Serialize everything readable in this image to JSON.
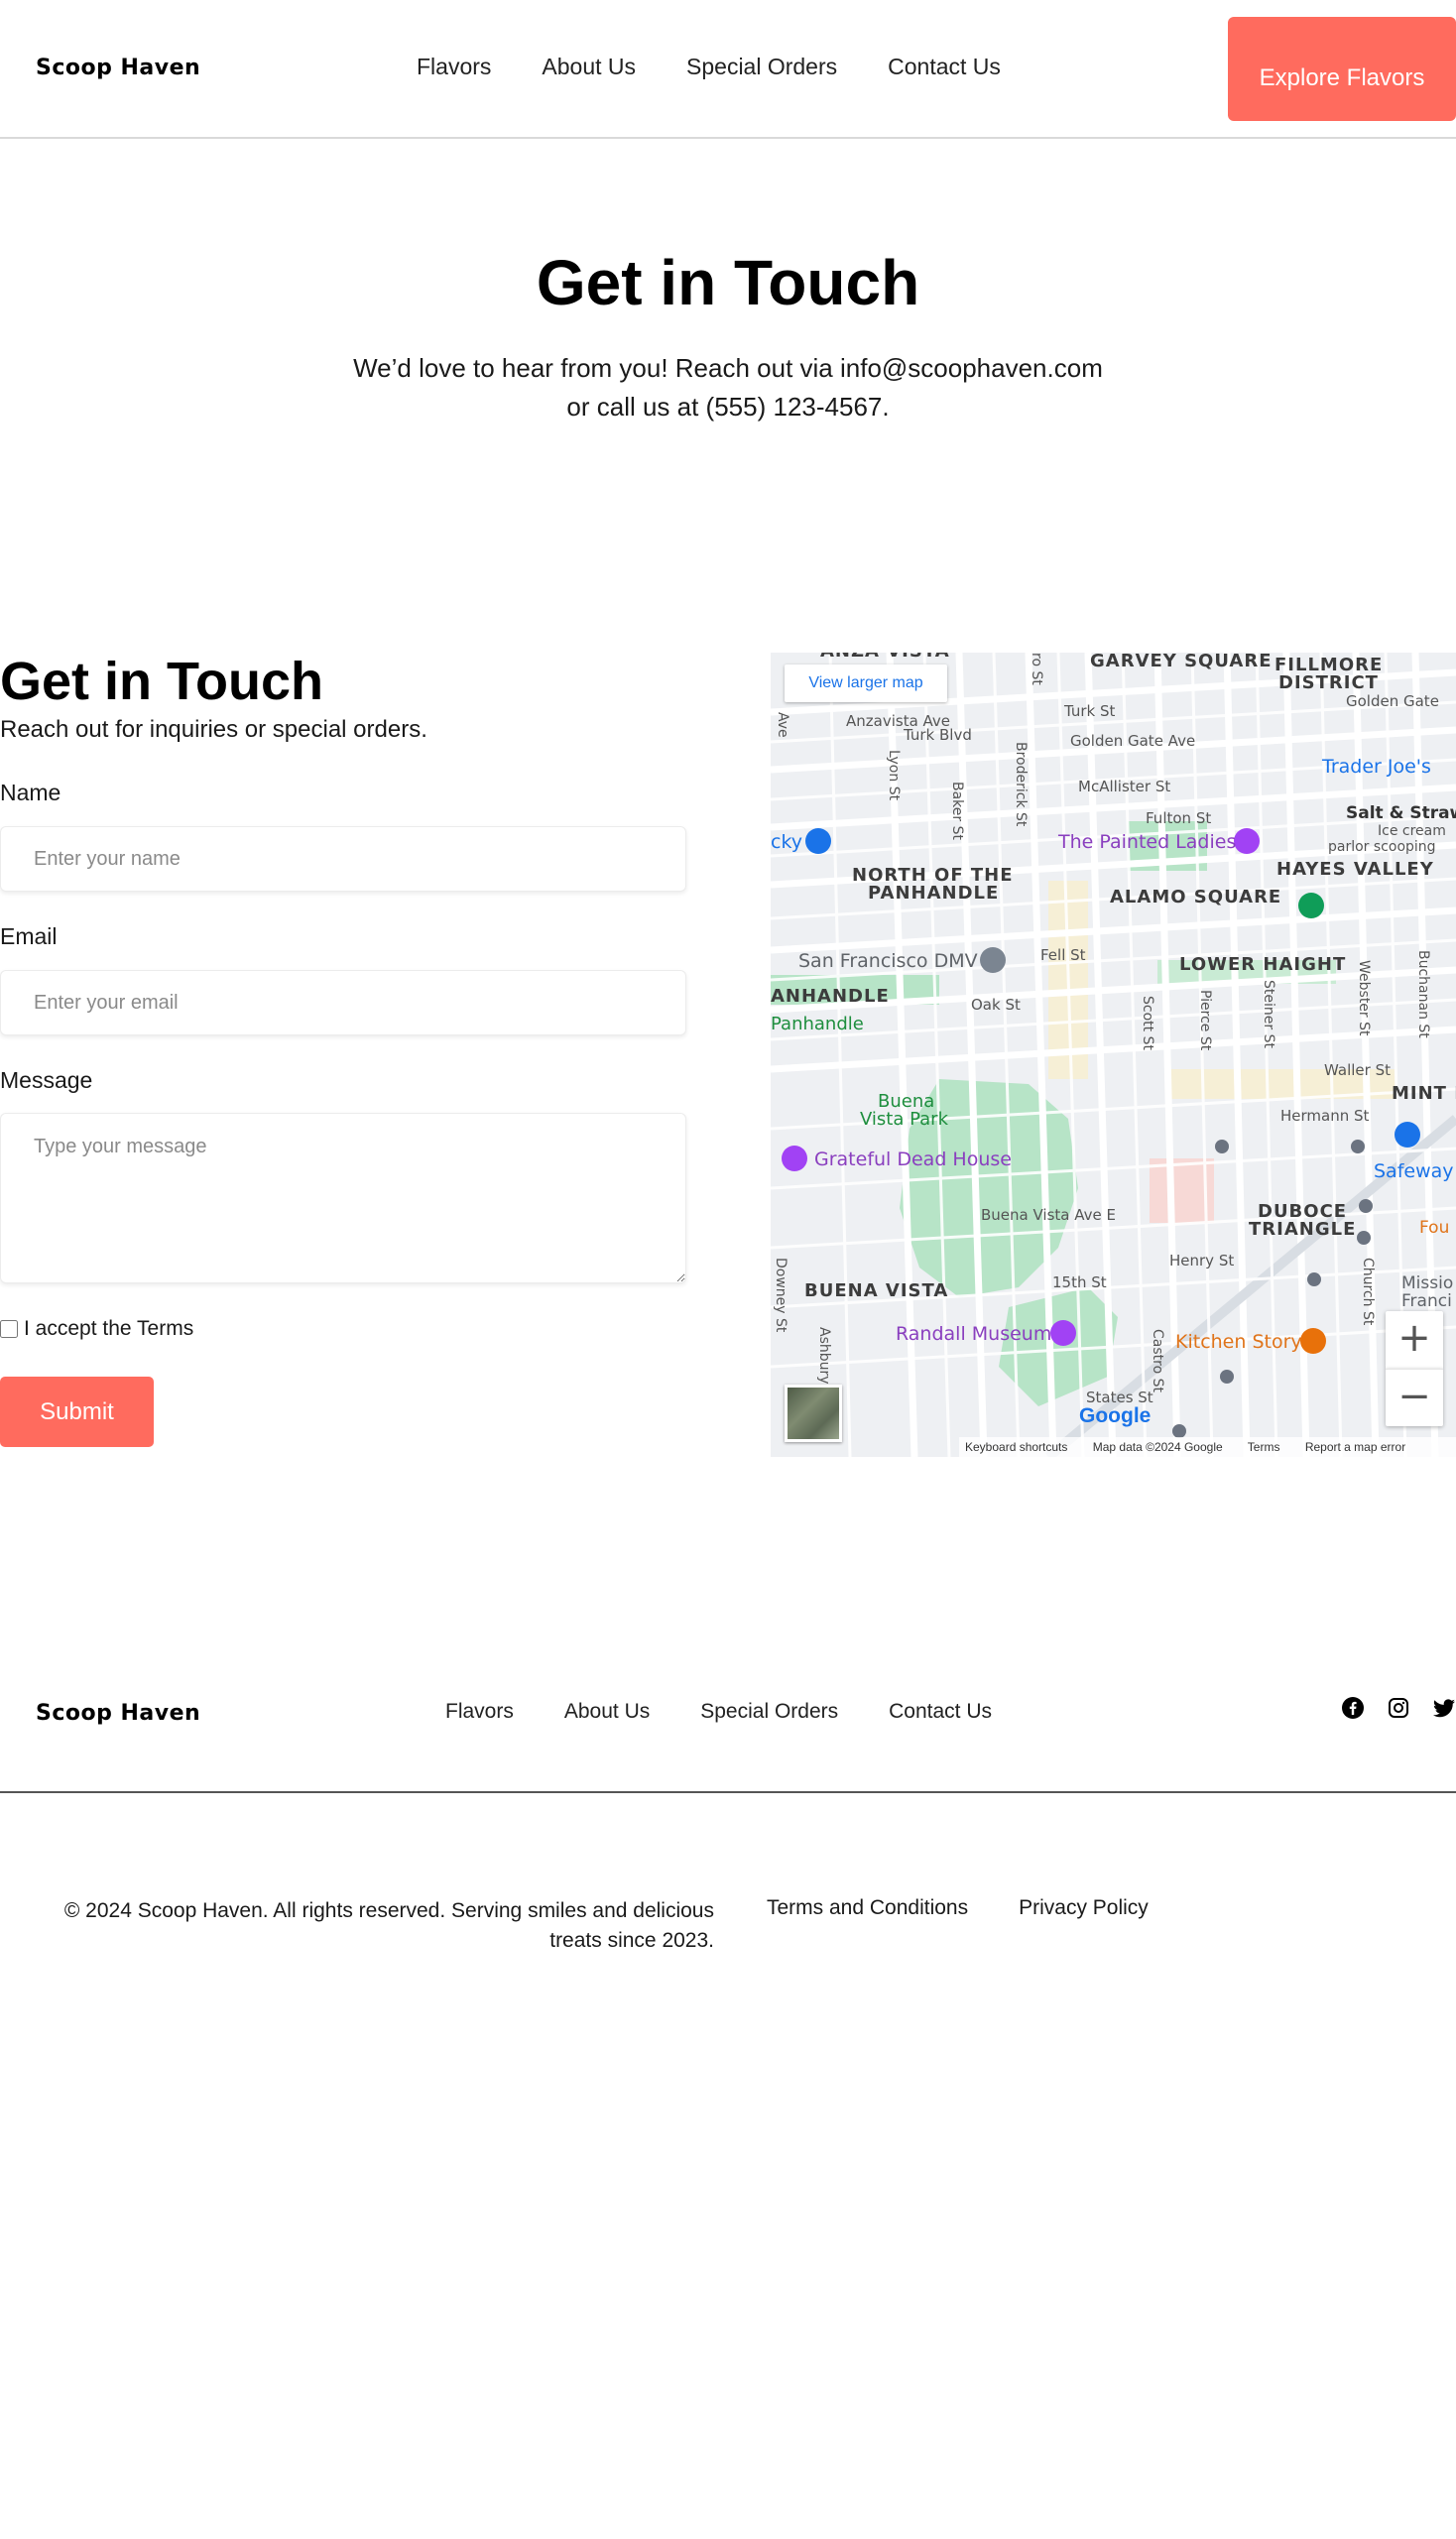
{
  "header": {
    "logo": "Scoop Haven",
    "nav": [
      "Flavors",
      "About Us",
      "Special Orders",
      "Contact Us"
    ],
    "cta": "Explore Flavors"
  },
  "hero": {
    "title": "Get in Touch",
    "subtitle_line1": "We’d love to hear from you! Reach out via info@scoophaven.com",
    "subtitle_line2": "or call us at (555) 123-4567."
  },
  "contact_form": {
    "title": "Get in Touch",
    "subtitle": "Reach out for inquiries or special orders.",
    "name_label": "Name",
    "name_placeholder": "Enter your name",
    "email_label": "Email",
    "email_placeholder": "Enter your email",
    "message_label": "Message",
    "message_placeholder": "Type your message",
    "terms_label": "I accept the Terms",
    "terms_checked": false,
    "submit_label": "Submit"
  },
  "map": {
    "view_larger": "View larger map",
    "districts": [
      "GARVEY SQUARE",
      "FILLMORE",
      "DISTRICT",
      "NORTH OF THE",
      "PANHANDLE",
      "ALAMO SQUARE",
      "HAYES VALLEY",
      "LOWER HAIGHT",
      "ANHANDLE",
      "MINT H",
      "DUBOCE",
      "TRIANGLE",
      "BUENA VISTA"
    ],
    "streets": [
      "Turk St",
      "Turk Blvd",
      "Golden Gate Ave",
      "Golden Gate",
      "Anzavista Ave",
      "McAllister St",
      "Fulton St",
      "Fell St",
      "Oak St",
      "Waller St",
      "Hermann St",
      "Henry St",
      "15th St",
      "States St",
      "Buena Vista Ave E",
      "Lyon St",
      "Baker St",
      "Broderick St",
      "Scott St",
      "Pierce St",
      "Steiner St",
      "Webster St",
      "Buchanan St",
      "Castro St",
      "Church St",
      "Downey St",
      "Ashbury St",
      "Ave",
      "ro St",
      "ANZA VISTA"
    ],
    "pois": [
      "The Painted Ladies",
      "Trader Joe's",
      "Salt & Straw",
      "Ice cream",
      "parlor scooping",
      "San Francisco DMV",
      "Panhandle",
      "Buena",
      "Vista Park",
      "Grateful Dead House",
      "Safeway",
      "Randall Museum",
      "Kitchen Story",
      "Missio",
      "Franci",
      "Fou",
      "cky"
    ],
    "zoom_in": "+",
    "zoom_out": "−",
    "google": "Google",
    "attribution": [
      "Keyboard shortcuts",
      "Map data ©2024 Google",
      "Terms",
      "Report a map error"
    ]
  },
  "footer": {
    "logo": "Scoop Haven",
    "nav": [
      "Flavors",
      "About Us",
      "Special Orders",
      "Contact Us"
    ],
    "social": [
      "facebook-icon",
      "instagram-icon",
      "twitter-icon"
    ],
    "copyright_line1": "© 2024 Scoop Haven. All rights reserved. Serving smiles and delicious",
    "copyright_line2": "treats since 2023.",
    "legal": [
      "Terms and Conditions",
      "Privacy Policy"
    ]
  },
  "colors": {
    "accent": "#ff6b5e",
    "map_park": "#b7e4c7",
    "map_road": "#ffffff",
    "poi_purple": "#a142f4",
    "poi_blue": "#1a73e8",
    "poi_green": "#0f9d58",
    "poi_orange": "#e8710a"
  }
}
